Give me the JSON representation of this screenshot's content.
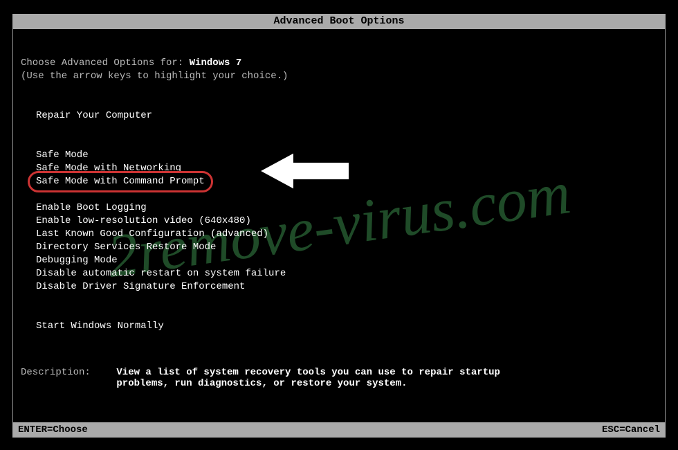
{
  "title": "Advanced Boot Options",
  "header": {
    "prefix": "Choose Advanced Options for: ",
    "os": "Windows 7",
    "hint": "(Use the arrow keys to highlight your choice.)"
  },
  "menu": {
    "group1": [
      "Repair Your Computer"
    ],
    "group2": [
      "Safe Mode",
      "Safe Mode with Networking",
      "Safe Mode with Command Prompt"
    ],
    "group3": [
      "Enable Boot Logging",
      "Enable low-resolution video (640x480)",
      "Last Known Good Configuration (advanced)",
      "Directory Services Restore Mode",
      "Debugging Mode",
      "Disable automatic restart on system failure",
      "Disable Driver Signature Enforcement"
    ],
    "group4": [
      "Start Windows Normally"
    ],
    "highlighted_index": {
      "group": 2,
      "item": 2
    }
  },
  "description": {
    "label": "Description:",
    "text": "View a list of system recovery tools you can use to repair startup problems, run diagnostics, or restore your system."
  },
  "footer": {
    "left": "ENTER=Choose",
    "right": "ESC=Cancel"
  },
  "watermark": "2remove-virus.com",
  "colors": {
    "highlight_ring": "#cc3333",
    "text_dim": "#bbbbbb",
    "text_bright": "#ffffff",
    "bar": "#aaaaaa",
    "watermark": "#2d6b3a"
  }
}
